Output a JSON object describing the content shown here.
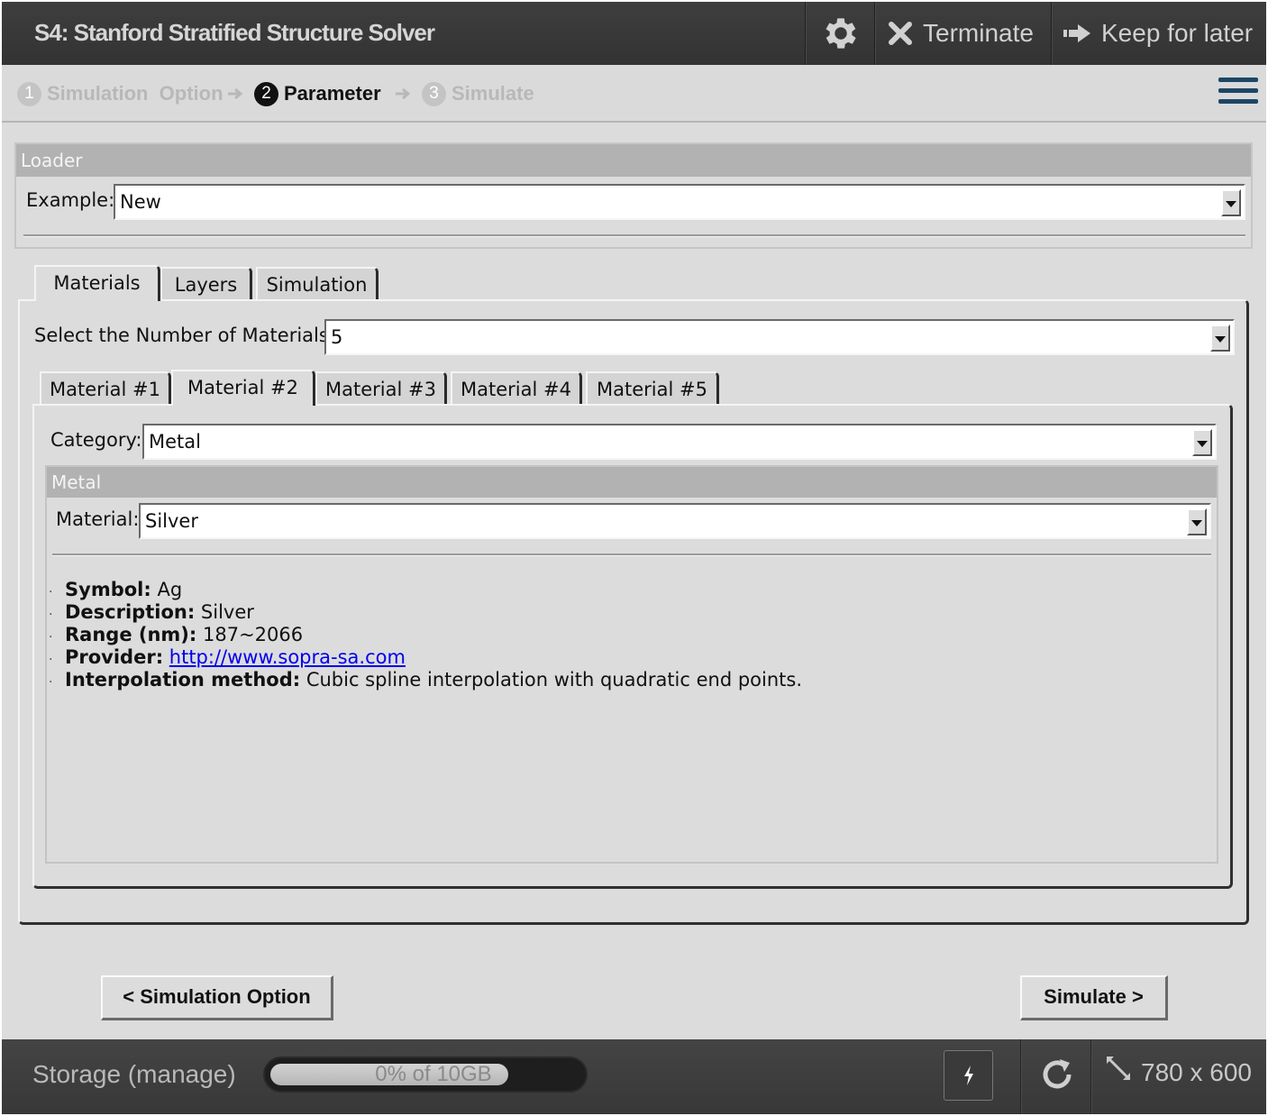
{
  "app": {
    "title": "S4: Stanford Stratified Structure Solver",
    "terminate_label": "Terminate",
    "keep_label": "Keep for later",
    "icons": {
      "settings": "gear-icon",
      "terminate": "close-icon",
      "keep": "arrow-right-icon",
      "menu": "hamburger-icon"
    }
  },
  "steps": [
    {
      "num": "1",
      "label": "Simulation  Option",
      "state": "done"
    },
    {
      "num": "2",
      "label": "Parameter",
      "state": "active"
    },
    {
      "num": "3",
      "label": "Simulate",
      "state": "pending"
    }
  ],
  "loader": {
    "header": "Loader",
    "example_label": "Example:",
    "example_value": "New"
  },
  "main_tabs": [
    "Materials",
    "Layers",
    "Simulation"
  ],
  "materials": {
    "count_label": "Select the Number of Materials:",
    "count_value": "5",
    "tabs": [
      "Material #1",
      "Material #2",
      "Material #3",
      "Material #4",
      "Material #5"
    ],
    "active_tab": "Material #2",
    "category_label": "Category:",
    "category_value": "Metal",
    "group_header": "Metal",
    "material_label": "Material:",
    "material_value": "Silver",
    "details": {
      "symbol_label": "Symbol:",
      "symbol": "Ag",
      "description_label": "Description:",
      "description": "Silver",
      "range_label": "Range (nm):",
      "range": "187~2066",
      "provider_label": "Provider:",
      "provider": "http://www.sopra-sa.com",
      "interp_label": "Interpolation method:",
      "interp": "Cubic spline interpolation with quadratic end points."
    }
  },
  "nav": {
    "back_label": "< Simulation Option",
    "next_label": "Simulate >"
  },
  "footer": {
    "storage_label": "Storage (manage)",
    "storage_text": "0% of 10GB",
    "storage_fraction": 0.0,
    "size_readout": "780 x 600",
    "icons": {
      "bolt": "bolt-icon",
      "refresh": "refresh-icon",
      "resize": "resize-icon"
    }
  },
  "colors": {
    "topbar": "#3a3a3a",
    "panel_header": "#b2b2b2",
    "link": "#0000ee",
    "menu_icon": "#1c4666"
  }
}
